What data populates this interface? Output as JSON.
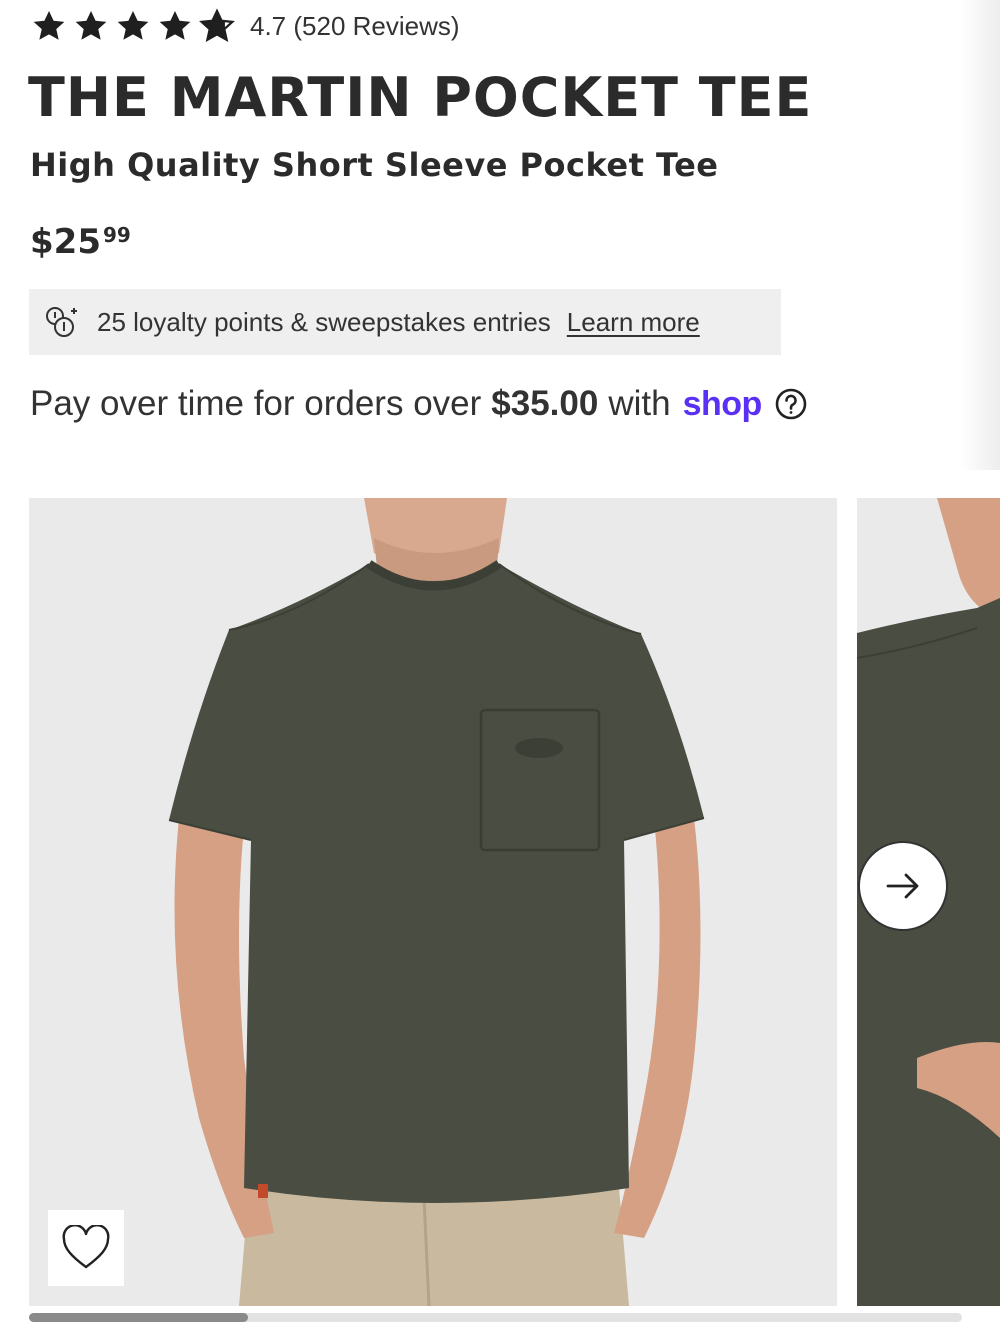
{
  "rating": {
    "stars": 4.7,
    "text": "4.7 (520 Reviews)"
  },
  "product": {
    "title": "THE MARTIN POCKET TEE",
    "subtitle": "High Quality Short Sleeve Pocket Tee",
    "price_main": "$25",
    "price_cents": "99"
  },
  "loyalty": {
    "icon": "loyalty-coins-icon",
    "text": "25 loyalty points & sweepstakes entries",
    "link_label": "Learn more"
  },
  "installments": {
    "prefix": "Pay over time for orders over",
    "amount": "$35.00",
    "suffix": "with",
    "brand": "shop",
    "brand_color": "#5a31f4",
    "help_icon": "question-circle-icon"
  },
  "gallery": {
    "image_alt": "Man wearing dark olive green pocket t-shirt with khaki pants",
    "shirt_color": "#4a4d42",
    "background_color": "#eaeaea",
    "wishlist_icon": "heart-outline-icon",
    "next_icon": "arrow-right-icon",
    "scroll_progress": 0.235
  }
}
